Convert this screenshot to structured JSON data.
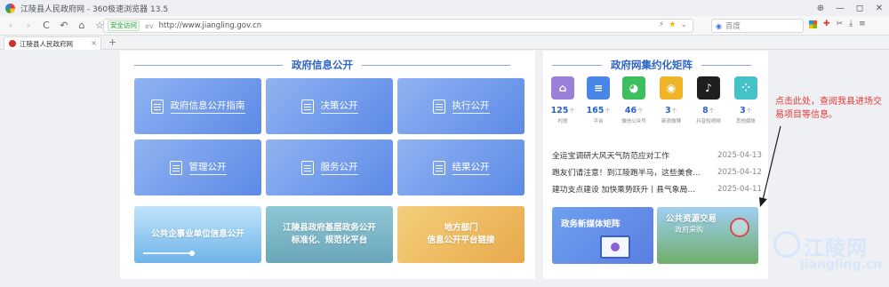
{
  "browser": {
    "window_title": "江陵县人民政府网 - 360极速浏览器 13.5",
    "win_controls": [
      "⊕",
      "—",
      "◻",
      "✕"
    ],
    "nav_icons": {
      "back": "‹",
      "forward": "›",
      "reload": "C",
      "undo": "↶",
      "home": "⌂",
      "favorite": "☆"
    },
    "address": {
      "secure_badge": "安全访问",
      "cert_label": "ev",
      "url": "http://www.jiangling.gov.cn"
    },
    "address_icons": {
      "compat": "⚡",
      "star": "★",
      "dropdown": "⌄"
    },
    "search_placeholder": "百度",
    "toolbar_icons": {
      "games": "✚",
      "tools": "✂",
      "download": "⤓",
      "menu": "≡"
    },
    "tab": {
      "label": "江陵县人民政府网",
      "close": "×"
    },
    "new_tab": "+"
  },
  "left_panel": {
    "title": "政府信息公开",
    "tiles": [
      {
        "label": "政府信息公开指南",
        "icon": "guide-icon"
      },
      {
        "label": "决策公开",
        "icon": "decision-icon"
      },
      {
        "label": "执行公开",
        "icon": "execution-icon"
      },
      {
        "label": "管理公开",
        "icon": "management-icon"
      },
      {
        "label": "服务公开",
        "icon": "service-icon"
      },
      {
        "label": "结果公开",
        "icon": "result-icon"
      }
    ],
    "banners": [
      {
        "label": "公共企事业单位信息公开"
      },
      {
        "line1": "江陵县政府基层政务公开",
        "line2": "标准化、规范化平台"
      },
      {
        "line1": "地方部门",
        "line2": "信息公开平台链接"
      }
    ]
  },
  "right_panel": {
    "title": "政府网集约化矩阵",
    "matrix": [
      {
        "value": "125",
        "unit": "个",
        "name": "村居",
        "color": "#9b7fd8",
        "icon": "⌂"
      },
      {
        "value": "165",
        "unit": "个",
        "name": "平台",
        "color": "#4a86e8",
        "icon": "≡"
      },
      {
        "value": "46",
        "unit": "个",
        "name": "微信公众号",
        "color": "#3dbf5f",
        "icon": "◕"
      },
      {
        "value": "3",
        "unit": "个",
        "name": "新浪微博",
        "color": "#f0b429",
        "icon": "◉"
      },
      {
        "value": "8",
        "unit": "个",
        "name": "抖音短视频",
        "color": "#1f1f1f",
        "icon": "♪"
      },
      {
        "value": "3",
        "unit": "个",
        "name": "其他媒体",
        "color": "#45c1c9",
        "icon": "⁘"
      }
    ],
    "news": [
      {
        "title": "全运宝调研大风天气防范应对工作",
        "date": "2025-04-13"
      },
      {
        "title": "跑友们请注意！到江陵跑半马，这些美食…",
        "date": "2025-04-12"
      },
      {
        "title": "建功支点建设 加快乘势跃升丨县气象局…",
        "date": "2025-04-11"
      }
    ],
    "promos": [
      {
        "label": "政务新媒体矩阵"
      },
      {
        "line1": "公共资源交易",
        "line2": "政府采购"
      }
    ]
  },
  "annotation": {
    "text": "点击此处，查阅我县进场交易项目等信息。",
    "color": "#e53935"
  },
  "watermark": {
    "name": "江陵网",
    "url": "jiangling.cn"
  },
  "colors": {
    "accent": "#2d64c8",
    "tile_start": "#8fb3f2",
    "tile_end": "#5d8ae6"
  }
}
